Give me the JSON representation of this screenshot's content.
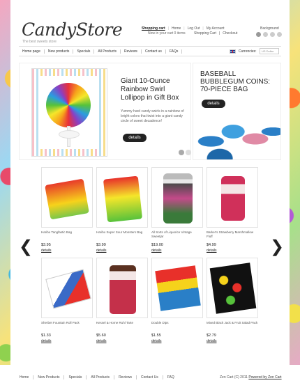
{
  "store": {
    "logo": "CandyStore",
    "tagline": "The best sweets store"
  },
  "top_links": {
    "shopping_cart": "Shopping cart",
    "home": "Home",
    "log_out": "Log Out",
    "my_account": "My Account",
    "cart_summary": "Now in your cart 0 items",
    "shopping_cart2": "Shopping Cart",
    "checkout": "Checkout",
    "background": "Background"
  },
  "nav": {
    "items": [
      "Home page",
      "New products",
      "Specials",
      "All Products",
      "Reviews",
      "Contact us",
      "FAQs"
    ],
    "currencies_label": "Currencies:",
    "currency_value": "US Dollar"
  },
  "banner": {
    "title": "Giant 10-Ounce Rainbow Swirl Lollipop in Gift Box",
    "description": "Yummy hard candy swirls in a rainbow of bright colors that twist into a giant candy circle of sweet decadence!",
    "details": "details",
    "side_title": "BASEBALL BUBBLEGUM COINS: 70-PIECE BAG",
    "side_details": "details"
  },
  "arrows": {
    "left": "❮",
    "right": "❯"
  },
  "products": [
    {
      "name": "Haribo Tangfastic Bag",
      "price": "$3.95",
      "details": "details"
    },
    {
      "name": "Haribo Super Sour Monsters Bag",
      "price": "$3.99",
      "details": "details"
    },
    {
      "name": "All Sorts of Liquorice Vintage Sweetjar",
      "price": "$19.00",
      "details": "details"
    },
    {
      "name": "Barker's Strawberry Marshmallow Fluff",
      "price": "$4.99",
      "details": "details"
    },
    {
      "name": "Sherbet Fountain Roll Pack",
      "price": "$1.33",
      "details": "details"
    },
    {
      "name": "Kessel & Horne Ruhl Tarte",
      "price": "$5.60",
      "details": "details"
    },
    {
      "name": "Double Dips",
      "price": "$1.55",
      "details": "details"
    },
    {
      "name": "Mixed Black Jack & Fruit Salad Pack",
      "price": "$2.79",
      "details": "details"
    }
  ],
  "footer": {
    "nav": [
      "Home",
      "New Products",
      "Specials",
      "All Products",
      "Reviews",
      "Contact Us",
      "FAQ"
    ],
    "copyright": "Zen Cart (C) 2011 ",
    "powered": "Powered by Zen Cart"
  }
}
